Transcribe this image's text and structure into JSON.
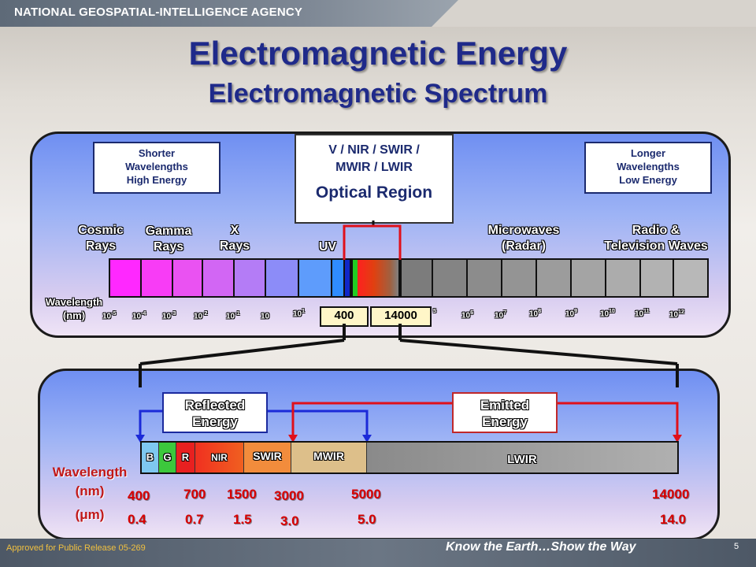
{
  "header": {
    "agency": "NATIONAL GEOSPATIAL-INTELLIGENCE AGENCY"
  },
  "title": {
    "main": "Electromagnetic Energy",
    "sub": "Electromagnetic Spectrum"
  },
  "top_panel": {
    "shorter": [
      "Shorter",
      "Wavelengths",
      "High Energy"
    ],
    "longer": [
      "Longer",
      "Wavelengths",
      "Low Energy"
    ],
    "optical": {
      "line1": "V / NIR / SWIR /",
      "line2": "MWIR / LWIR",
      "name": "Optical Region"
    },
    "regions": {
      "cosmic": [
        "Cosmic",
        "Rays"
      ],
      "gamma": [
        "Gamma",
        "Rays"
      ],
      "xrays": [
        "X",
        "Rays"
      ],
      "uv": "UV",
      "micro": [
        "Microwaves",
        "(Radar)"
      ],
      "radio": [
        "Radio &",
        "Television Waves"
      ]
    },
    "axis_label": [
      "Wavelength",
      "(nm)"
    ],
    "ticks": [
      {
        "base": "10",
        "exp": "-5"
      },
      {
        "base": "10",
        "exp": "-4"
      },
      {
        "base": "10",
        "exp": "-3"
      },
      {
        "base": "10",
        "exp": "-2"
      },
      {
        "base": "10",
        "exp": "-1"
      },
      {
        "base": "10",
        "exp": ""
      },
      {
        "base": "10",
        "exp": "1"
      },
      {
        "base": "",
        "exp": "5"
      },
      {
        "base": "10",
        "exp": "6"
      },
      {
        "base": "10",
        "exp": "7"
      },
      {
        "base": "10",
        "exp": "8"
      },
      {
        "base": "10",
        "exp": "9"
      },
      {
        "base": "10",
        "exp": "10"
      },
      {
        "base": "10",
        "exp": "11"
      },
      {
        "base": "10",
        "exp": "12"
      }
    ],
    "range_start": "400",
    "range_end": "14000"
  },
  "bottom_panel": {
    "reflected": [
      "Reflected",
      "Energy"
    ],
    "emitted": [
      "Emitted",
      "Energy"
    ],
    "bands": [
      "B",
      "G",
      "R",
      "NIR",
      "SWIR",
      "MWIR",
      "LWIR"
    ],
    "wavelength_label": "Wavelength",
    "nm_label": "(nm)",
    "um_label": "(μm)",
    "nm_values": [
      "400",
      "700",
      "1500",
      "3000",
      "5000",
      "14000"
    ],
    "um_values": [
      "0.4",
      "0.7",
      "1.5",
      "3.0",
      "5.0",
      "14.0"
    ]
  },
  "footer": {
    "approved": "Approved for Public Release 05-269",
    "motto": "Know the Earth…Show the Way",
    "page": "5"
  },
  "colors": {
    "title": "#1f2a8a",
    "reflected": "#1b2a9e",
    "emitted": "#c0282a",
    "wavelength": "#d80000"
  }
}
